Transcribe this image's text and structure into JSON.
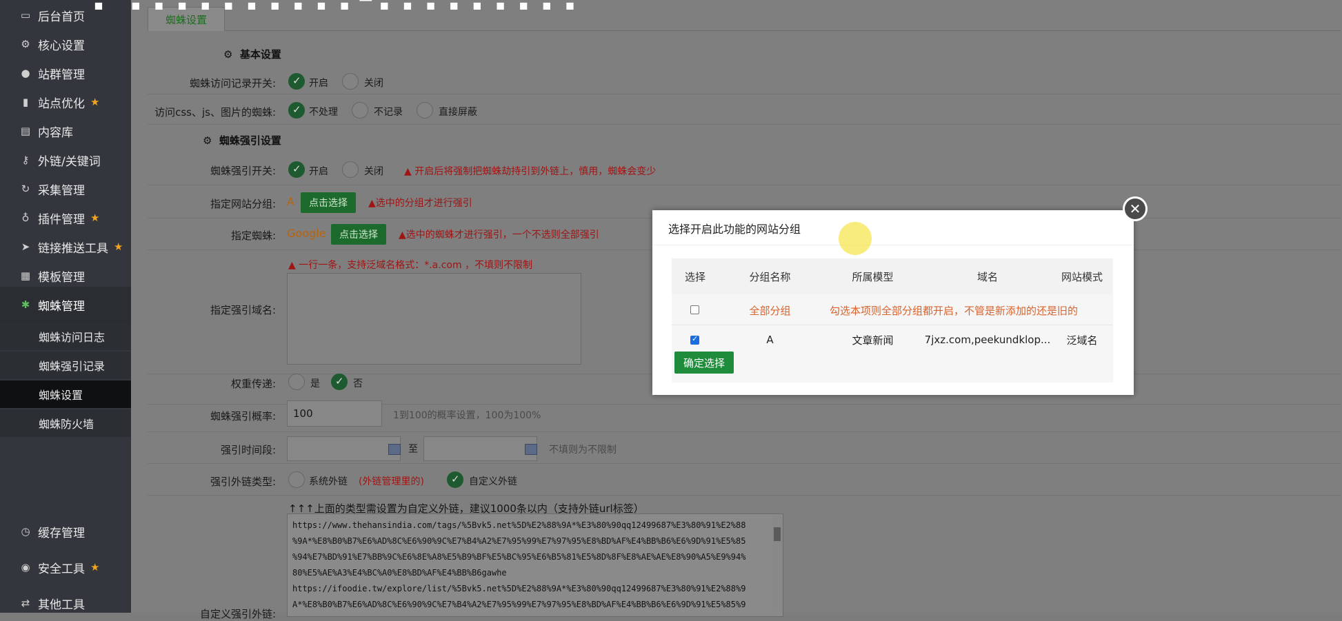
{
  "overlay": {
    "caption": "? ??????????-?????????"
  },
  "sidebar": {
    "items": [
      {
        "icon": "monitor-icon",
        "label": "后台首页"
      },
      {
        "icon": "gear-icon",
        "label": "核心设置"
      },
      {
        "icon": "user-icon",
        "label": "站群管理"
      },
      {
        "icon": "bar-chart-icon",
        "label": "站点优化",
        "pin": "★"
      },
      {
        "icon": "document-icon",
        "label": "内容库"
      },
      {
        "icon": "key-icon",
        "label": "外链/关键词"
      },
      {
        "icon": "refresh-icon",
        "label": "采集管理"
      },
      {
        "icon": "plug-icon",
        "label": "插件管理",
        "pin": "★"
      },
      {
        "icon": "send-icon",
        "label": "链接推送工具",
        "pin": "★"
      },
      {
        "icon": "template-icon",
        "label": "模板管理"
      },
      {
        "icon": "spider-icon",
        "label": "蜘蛛管理"
      },
      {
        "icon": "timer-icon",
        "label": "缓存管理"
      },
      {
        "icon": "bulb-icon",
        "label": "安全工具",
        "pin": "★"
      },
      {
        "icon": "shuffle-icon",
        "label": "其他工具"
      }
    ],
    "sub_items": [
      "蜘蛛访问日志",
      "蜘蛛强引记录",
      "蜘蛛设置",
      "蜘蛛防火墙"
    ]
  },
  "tabs": {
    "active": "蜘蛛设置"
  },
  "form": {
    "section_basic": "基本设置",
    "visit_log_label": "蜘蛛访问记录开关:",
    "on": "开启",
    "off": "关闭",
    "css_label": "访问css、js、图片的蜘蛛:",
    "no_process": "不处理",
    "no_record": "不记录",
    "block": "直接屏蔽",
    "section_force": "蜘蛛强引设置",
    "force_switch_label": "蜘蛛强引开关:",
    "force_warn": "开启后将强制把蜘蛛劫持引到外链上，慎用，蜘蛛会变少",
    "group_label": "指定网站分组:",
    "group_value": "A",
    "choose_btn": "点击选择",
    "group_warn": "选中的分组才进行强引",
    "spider_label": "指定蜘蛛:",
    "spider_value": "Google",
    "spider_warn": "选中的蜘蛛才进行强引，一个不选则全部强引",
    "domain_warn": "一行一条，支持泛域名格式：*.a.com ，不填则不限制",
    "domain_label": "指定强引域名:",
    "weight_label": "权重传递:",
    "yes": "是",
    "no": "否",
    "rate_label": "蜘蛛强引概率:",
    "rate_value": "100",
    "rate_hint": "1到100的概率设置，100为100%",
    "time_label": "强引时间段:",
    "to": "至",
    "time_hint": "不填则为不限制",
    "type_label": "强引外链类型:",
    "type_system": "系统外链",
    "type_system_note": "(外链管理里的)",
    "type_custom": "自定义外链",
    "custom_hint": "↑↑↑上面的类型需设置为自定义外链，建议1000条以内（支持外链url标签）",
    "custom_label": "自定义强引外链:",
    "custom_lines": [
      "https://www.thehansindia.com/tags/%5Bvk5.net%5D%E2%88%9A*%E3%80%90qq12499687%E3%80%91%E2%88",
      "%9A*%E8%B0%B7%E6%AD%8C%E6%90%9C%E7%B4%A2%E7%95%99%E7%97%95%E8%BD%AF%E4%BB%B6%E6%9D%91%E5%85",
      "%94%E7%BD%91%E7%BB%9C%E6%8E%A8%E5%B9%BF%E5%BC%95%E6%B5%81%E5%8D%8F%E8%AE%AE%E8%90%A5%E9%94%",
      "80%E5%AE%A3%E4%BC%A0%E8%BD%AF%E4%BB%B6gawhe",
      "https://ifoodie.tw/explore/list/%5Bvk5.net%5D%E2%88%9A*%E3%80%90qq12499687%E3%80%91%E2%88%9",
      "A*%E8%B0%B7%E6%AD%8C%E6%90%9C%E7%B4%A2%E7%95%99%E7%97%95%E8%BD%AF%E4%BB%B6%E6%9D%91%E5%85%9"
    ]
  },
  "modal": {
    "title": "选择开启此功能的网站分组",
    "close": "✕",
    "headers": [
      "选择",
      "分组名称",
      "所属模型",
      "域名",
      "网站模式"
    ],
    "all_row": {
      "name": "全部分组",
      "note": "勾选本项则全部分组都开启，不管是新添加的还是旧的"
    },
    "rows": [
      {
        "name": "A",
        "model": "文章新闻",
        "domain": "7jxz.com,peekundklop...",
        "mode": "泛域名"
      }
    ],
    "confirm": "确定选择"
  },
  "colors": {
    "accent_green": "#1f8c3b",
    "warn_red": "#a11414",
    "orange": "#d9622b"
  }
}
